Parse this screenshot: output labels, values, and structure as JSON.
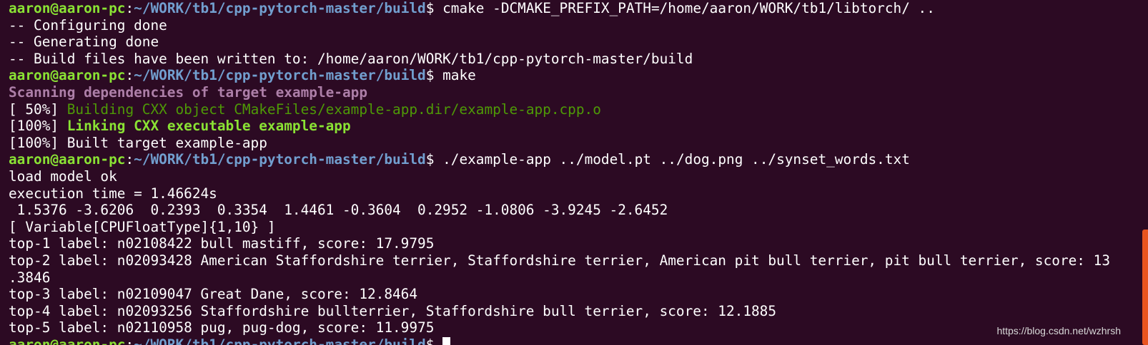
{
  "prompt": {
    "user_host": "aaron@aaron-pc",
    "colon": ":",
    "path": "~/WORK/tb1/cpp-pytorch-master/build",
    "dollar": "$ "
  },
  "lines": {
    "cmd1": "cmake -DCMAKE_PREFIX_PATH=/home/aaron/WORK/tb1/libtorch/ ..",
    "configuring": "-- Configuring done",
    "generating": "-- Generating done",
    "build_files": "-- Build files have been written to: /home/aaron/WORK/tb1/cpp-pytorch-master/build",
    "cmd2": "make",
    "scanning": "Scanning dependencies of target example-app",
    "pct_50": "[ 50%] ",
    "building": "Building CXX object CMakeFiles/example-app.dir/example-app.cpp.o",
    "pct_100a": "[100%] ",
    "linking": "Linking CXX executable example-app",
    "built": "[100%] Built target example-app",
    "cmd3": "./example-app ../model.pt ../dog.png ../synset_words.txt",
    "load_model": "load model ok",
    "exec_time": "execution time = 1.46624s",
    "tensor_values": " 1.5376 -3.6206  0.2393  0.3354  1.4461 -0.3604  0.2952 -1.0806 -3.9245 -2.6452",
    "variable": "[ Variable[CPUFloatType]{1,10} ]",
    "top1": "top-1 label: n02108422 bull mastiff, score: 17.9795",
    "top2": "top-2 label: n02093428 American Staffordshire terrier, Staffordshire terrier, American pit bull terrier, pit bull terrier, score: 13",
    "top2_wrap": ".3846",
    "top3": "top-3 label: n02109047 Great Dane, score: 12.8464",
    "top4": "top-4 label: n02093256 Staffordshire bullterrier, Staffordshire bull terrier, score: 12.1885",
    "top5": "top-5 label: n02110958 pug, pug-dog, score: 11.9975"
  },
  "watermark": "https://blog.csdn.net/wzhrsh",
  "colors": {
    "background": "#2c0a23",
    "user_host": "#8ae234",
    "path": "#729fcf",
    "scanning": "#ad7fa8",
    "building": "#4e9a06",
    "scrollbar": "#e95420"
  }
}
